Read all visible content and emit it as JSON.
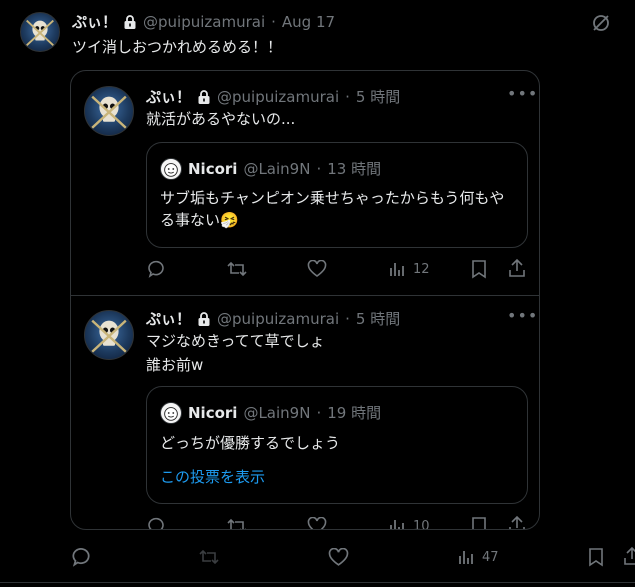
{
  "main_tweet": {
    "name": "ぷぃ！",
    "handle": "@puipuizamurai",
    "sep": "·",
    "time": "Aug 17",
    "text": "ツイ消しおつかれめるめる！！",
    "views": "47"
  },
  "quote1": {
    "name": "ぷぃ！",
    "handle": "@puipuizamurai",
    "sep": "·",
    "time": "5 時間",
    "text": "就活があるやないの...",
    "views": "12",
    "inner": {
      "name": "Nicori",
      "handle": "@Lain9N",
      "sep": "·",
      "time": "13 時間",
      "text": "サブ垢もチャンピオン乗せちゃったからもう何もやる事ない🤧"
    }
  },
  "quote2": {
    "name": "ぷぃ！",
    "handle": "@puipuizamurai",
    "sep": "·",
    "time": "5 時間",
    "text_line1": "マジなめきってて草でしょ",
    "text_line2": "誰お前w",
    "views": "10",
    "inner": {
      "name": "Nicori",
      "handle": "@Lain9N",
      "sep": "·",
      "time": "19 時間",
      "text": "どっちが優勝するでしょう",
      "link": "この投票を表示"
    }
  },
  "colors": {
    "background": "#000000",
    "muted": "#71767b",
    "border": "#2f3336",
    "link": "#1d9bf0"
  }
}
